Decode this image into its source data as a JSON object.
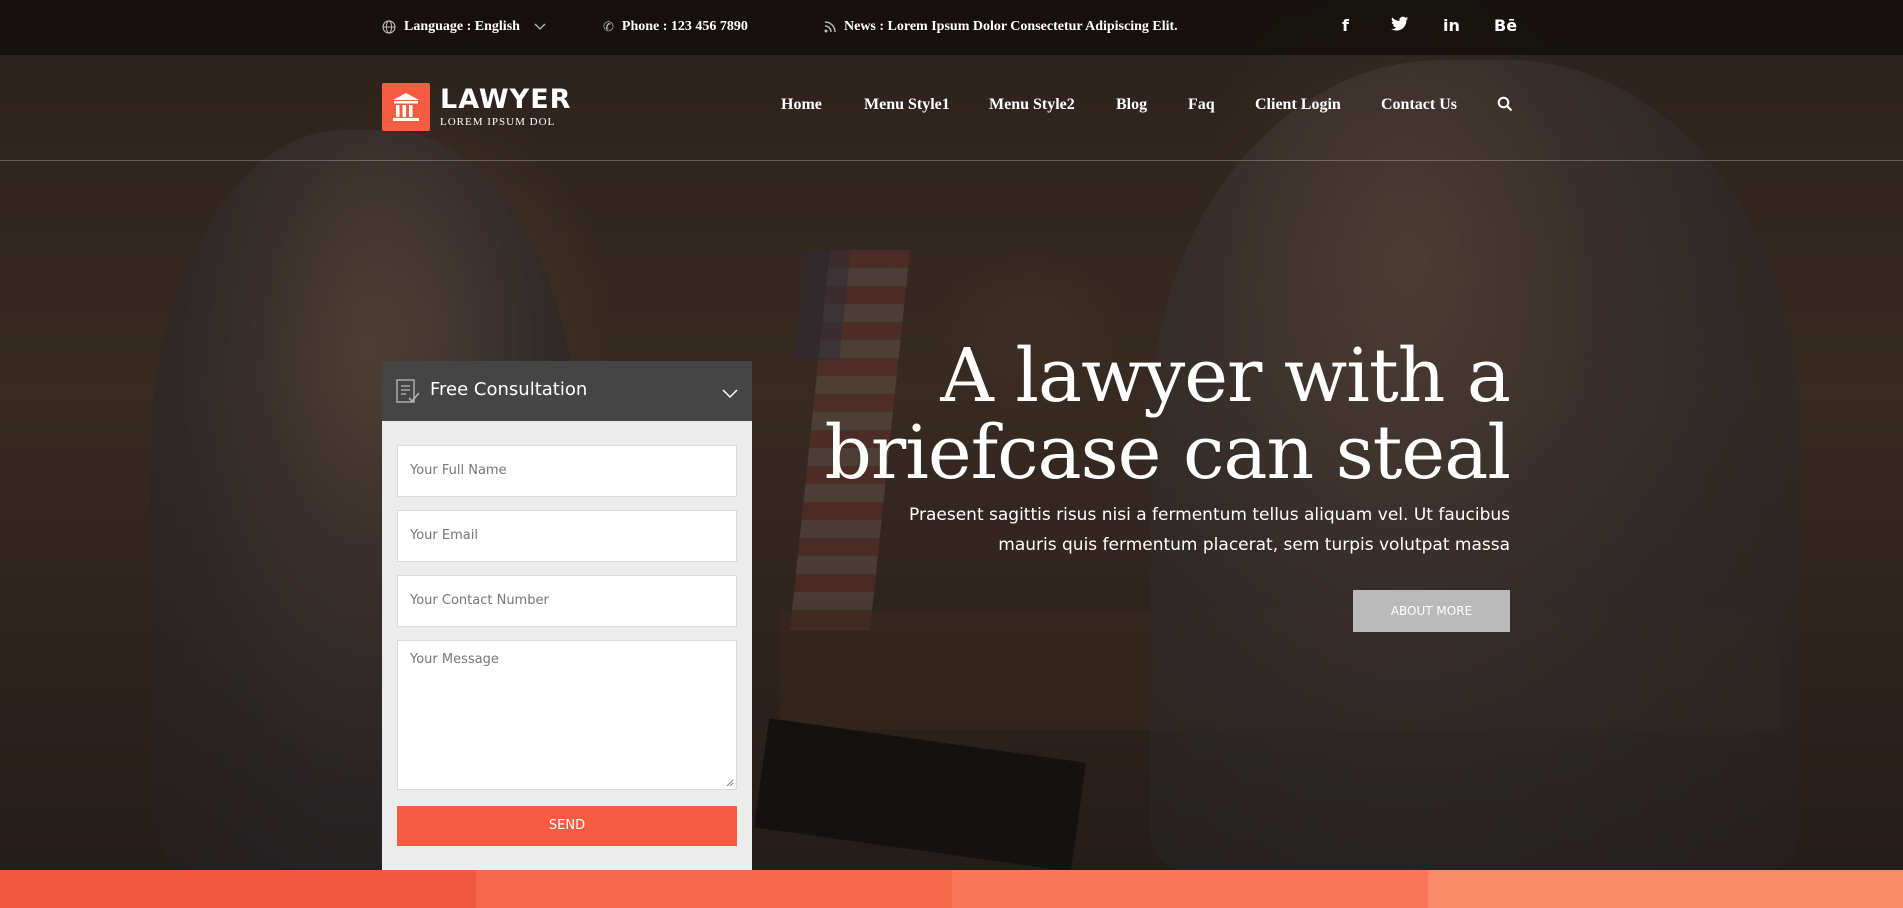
{
  "topbar": {
    "language": "Language : English",
    "phone": "Phone : 123 456 7890",
    "news": "News : Lorem Ipsum Dolor Consectetur Adipiscing Elit.",
    "social": [
      {
        "icon": "facebook-icon",
        "glyph": "f"
      },
      {
        "icon": "twitter-icon",
        "glyph": "🐦"
      },
      {
        "icon": "linkedin-icon",
        "glyph": "in"
      },
      {
        "icon": "behance-icon",
        "glyph": "Bē"
      }
    ]
  },
  "header": {
    "logo_title": "LAWYER",
    "logo_subtitle": "LOREM IPSUM DOL",
    "nav": [
      "Home",
      "Menu Style1",
      "Menu Style2",
      "Blog",
      "Faq",
      "Client Login",
      "Contact Us"
    ]
  },
  "form": {
    "title": "Free Consultation",
    "name_placeholder": "Your Full Name",
    "email_placeholder": "Your Email",
    "contact_placeholder": "Your Contact Number",
    "message_placeholder": "Your Message",
    "send_label": "SEND"
  },
  "hero": {
    "title_line1": "A lawyer with a",
    "title_line2": "briefcase can steal",
    "subtitle_line1": "Praesent sagittis risus nisi a fermentum tellus aliquam vel. Ut faucibus",
    "subtitle_line2": "mauris quis fermentum placerat, sem turpis volutpat massa",
    "button_label": "ABOUT MORE"
  },
  "colors": {
    "accent": "#f55d42",
    "strip": [
      "#f0593c",
      "#f5684a",
      "#f87858",
      "#fa8a6a"
    ]
  }
}
